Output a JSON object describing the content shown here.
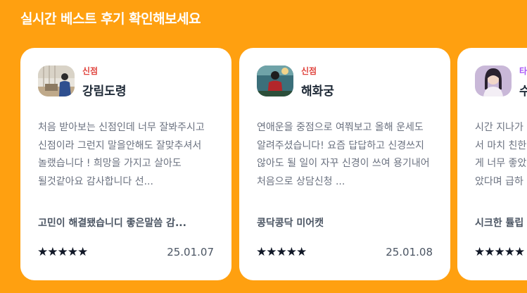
{
  "section_title": "실시간 베스트 후기 확인해보세요",
  "colors": {
    "background": "#FFA010",
    "card": "#FFFFFF",
    "category_red": "#E0443E",
    "category_purple": "#A855F7"
  },
  "reviews": [
    {
      "category": "신점",
      "counselor": "강림도령",
      "body": "처음 받아보는 신점인데 너무 잘봐주시고 신점이라 그런지 말을안해도 잘맞추셔서 놀랬습니다 ! 희망을 가지고 살아도 될것같아요 감사합니다 선...",
      "tagline": "고민이 해결됐습니디 좋은말씀 감...",
      "rating": 5,
      "stars": "★★★★★",
      "date": "25.01.07",
      "avatar_icon": "counselor-photo-icon"
    },
    {
      "category": "신점",
      "counselor": "해화궁",
      "body": "연애운을 중점으로 여쭤보고 올해 운세도 알려주셨습니다! 요즘 답답하고 신경쓰지 않아도 될 일이 자꾸 신경이 쓰여 용기내어 처음으로 상담신청 ...",
      "tagline": "콩닥콩닥 미어캣",
      "rating": 5,
      "stars": "★★★★★",
      "date": "25.01.08",
      "avatar_icon": "counselor-photo-icon"
    },
    {
      "category": "타",
      "counselor": "수",
      "body": "시간 지나가\n서 마치 친한\n게 너무 좋았\n았다며 급하",
      "tagline": "시크한 튤립",
      "rating": 5,
      "stars": "★★★★★",
      "date": "",
      "avatar_icon": "counselor-photo-icon"
    }
  ]
}
